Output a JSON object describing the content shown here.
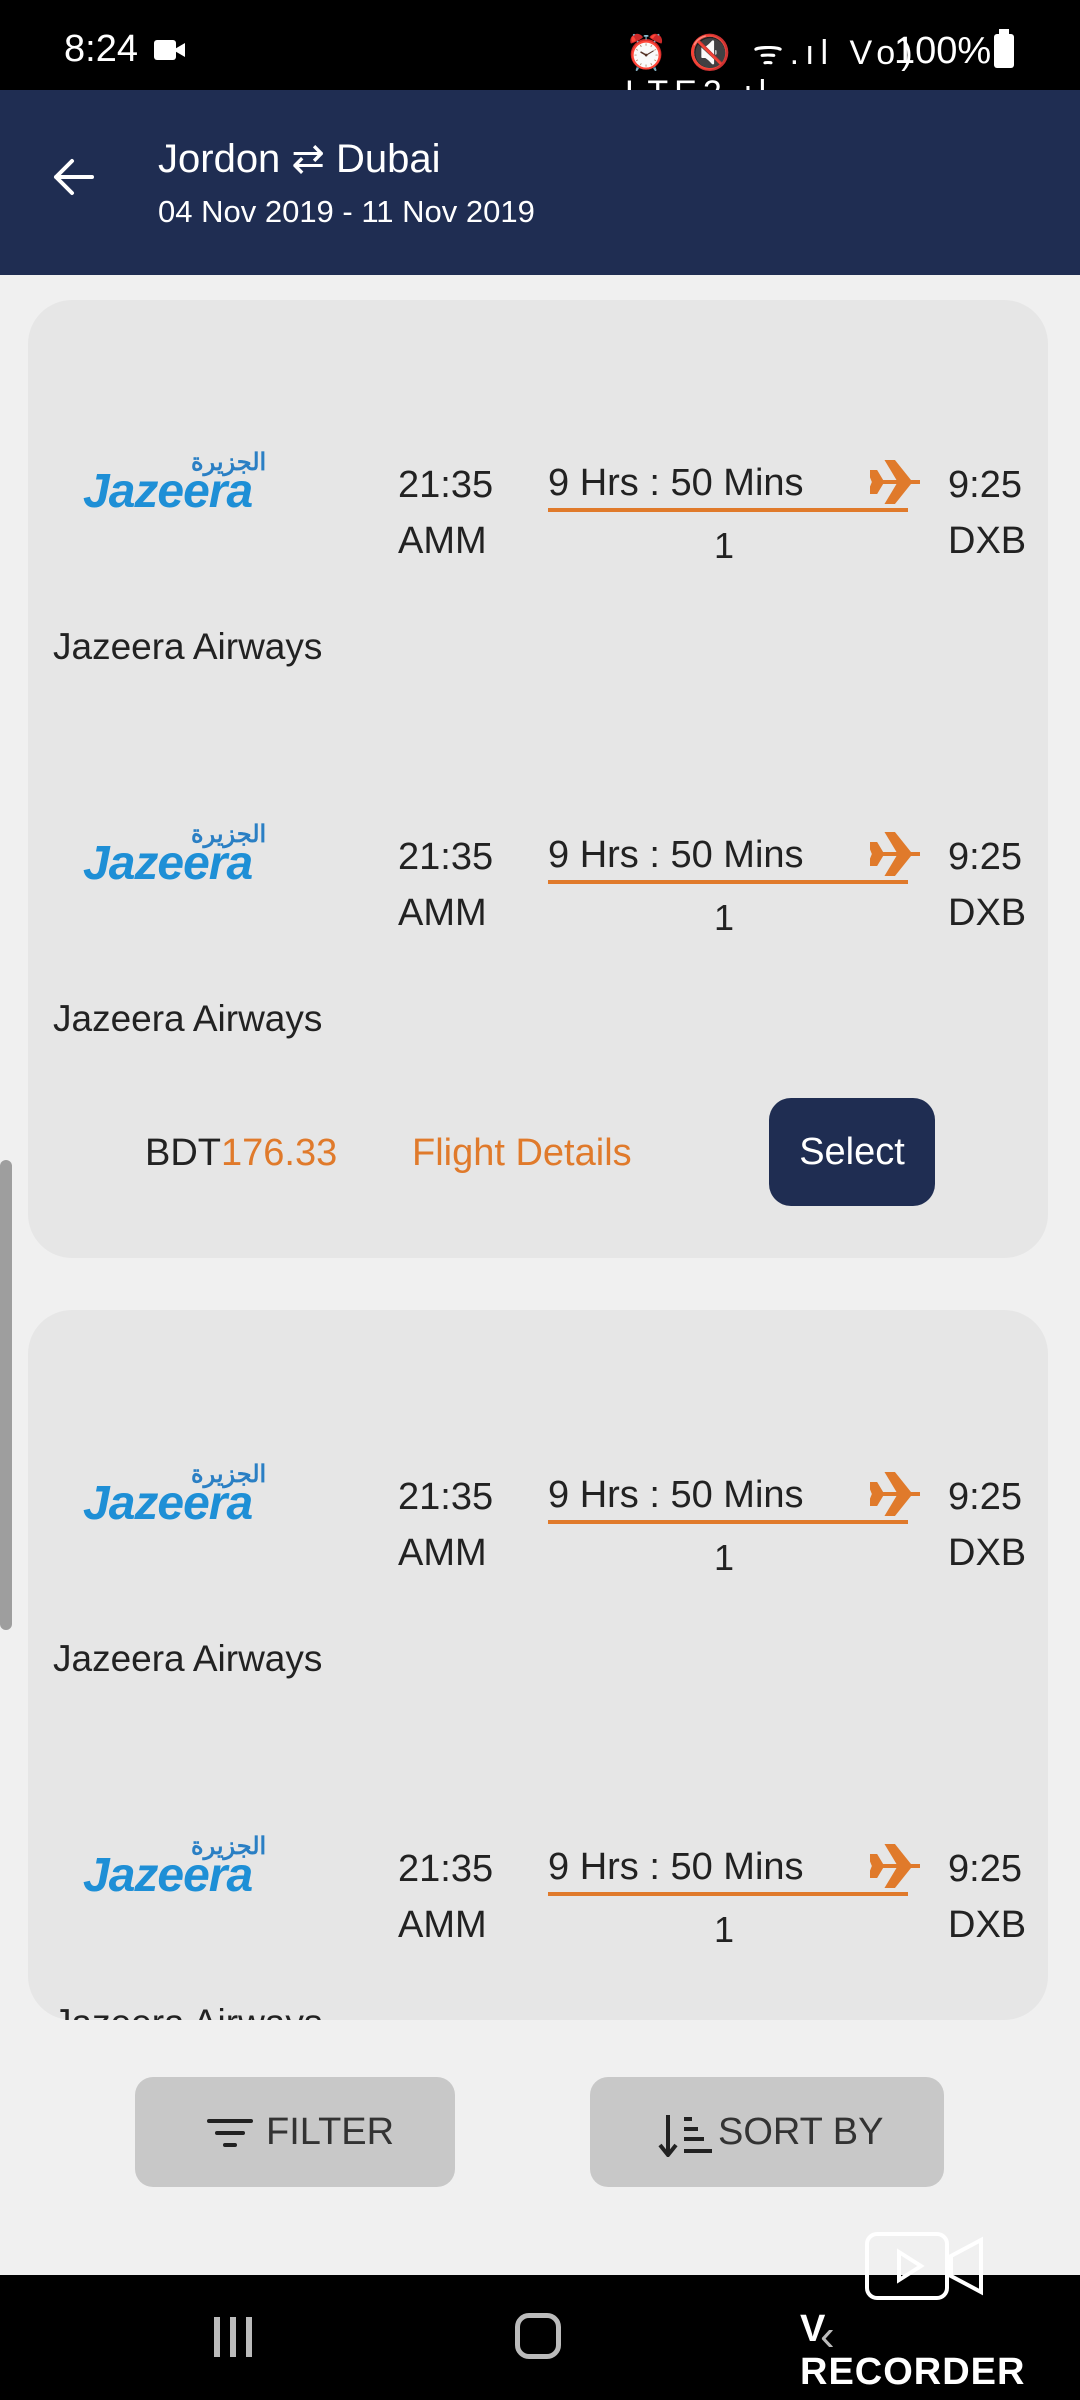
{
  "status_bar": {
    "time": "8:24",
    "icons": "⏰ 🔇 ᯤ.ıl Vo) LTE2.ıl",
    "battery_percent": "100%"
  },
  "header": {
    "title": "Jordon ⇄ Dubai",
    "dates": "04 Nov 2019 - 11 Nov 2019"
  },
  "logo": {
    "arabic": "الجزيرة",
    "english": "Jazeera"
  },
  "flights": [
    {
      "departure_time": "21:35",
      "departure_code": "AMM",
      "duration": "9 Hrs : 50 Mins",
      "stops": "1",
      "arrival_time": "9:25",
      "arrival_code": "DXB",
      "airline": "Jazeera Airways"
    },
    {
      "departure_time": "21:35",
      "departure_code": "AMM",
      "duration": "9 Hrs : 50 Mins",
      "stops": "1",
      "arrival_time": "9:25",
      "arrival_code": "DXB",
      "airline": "Jazeera Airways"
    },
    {
      "departure_time": "21:35",
      "departure_code": "AMM",
      "duration": "9 Hrs : 50 Mins",
      "stops": "1",
      "arrival_time": "9:25",
      "arrival_code": "DXB",
      "airline": "Jazeera Airways"
    },
    {
      "departure_time": "21:35",
      "departure_code": "AMM",
      "duration": "9 Hrs : 50 Mins",
      "stops": "1",
      "arrival_time": "9:25",
      "arrival_code": "DXB",
      "airline": "Jazeera Airways"
    }
  ],
  "offer": {
    "currency": "BDT",
    "amount": "176.33",
    "details_label": "Flight Details",
    "select_label": "Select"
  },
  "bottom_bar": {
    "filter_label": "FILTER",
    "sort_label": "SORT BY"
  },
  "watermark": {
    "text": "V RECORDER"
  },
  "colors": {
    "header_bg": "#1f2d52",
    "accent_orange": "#e07a2b",
    "card_bg": "#e6e6e6",
    "logo_blue": "#1e8fd6"
  }
}
